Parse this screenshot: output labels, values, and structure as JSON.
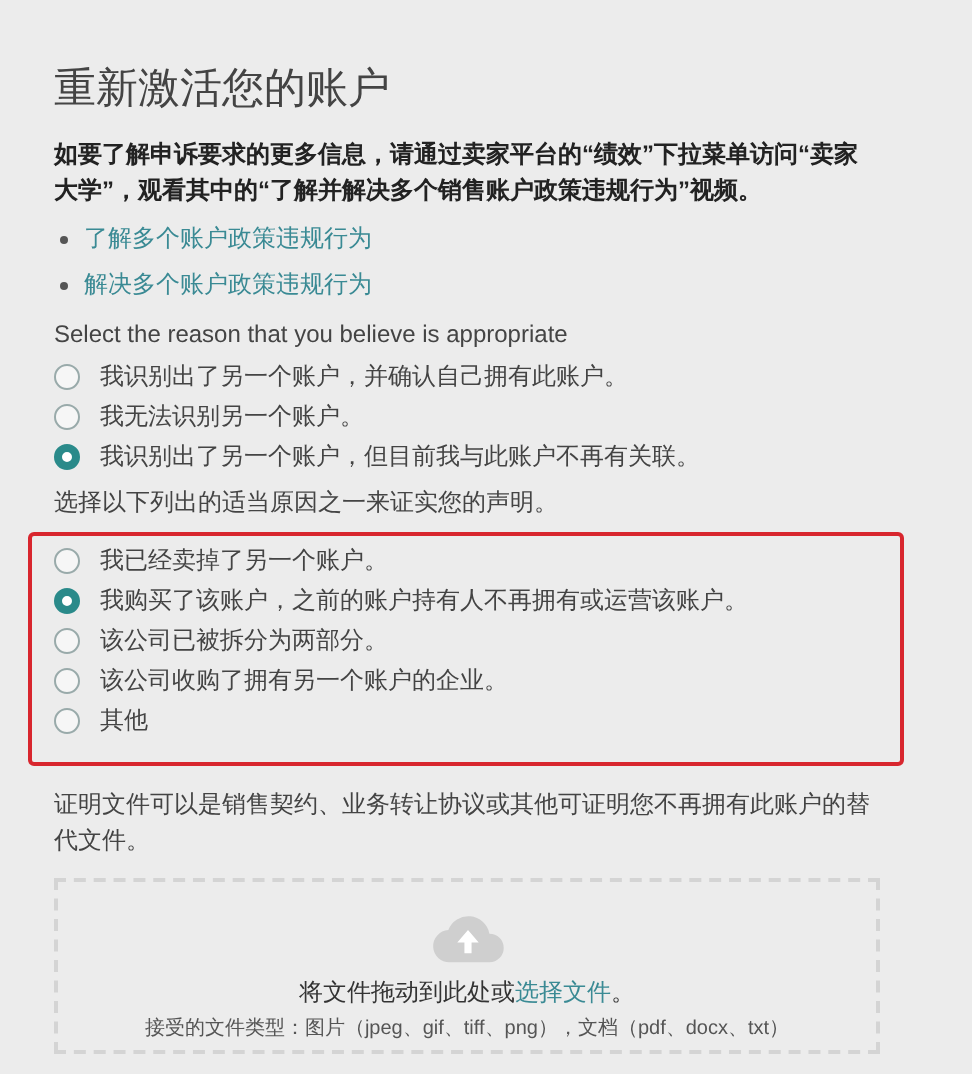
{
  "title": "重新激活您的账户",
  "intro": "如要了解申诉要求的更多信息，请通过卖家平台的“绩效”下拉菜单访问“卖家大学”，观看其中的“了解并解决多个销售账户政策违规行为”视频。",
  "links": [
    "了解多个账户政策违规行为",
    "解决多个账户政策违规行为"
  ],
  "reason_group": {
    "prompt": "Select the reason that you believe is appropriate",
    "highlighted": false,
    "options": [
      {
        "label": "我识别出了另一个账户，并确认自己拥有此账户。",
        "selected": false
      },
      {
        "label": "我无法识别另一个账户。",
        "selected": false
      },
      {
        "label": "我识别出了另一个账户，但目前我与此账户不再有关联。",
        "selected": true
      }
    ]
  },
  "statement_group": {
    "prompt": "选择以下列出的适当原因之一来证实您的声明。",
    "highlighted": true,
    "options": [
      {
        "label": "我已经卖掉了另一个账户。",
        "selected": false
      },
      {
        "label": "我购买了该账户，之前的账户持有人不再拥有或运营该账户。",
        "selected": true
      },
      {
        "label": "该公司已被拆分为两部分。",
        "selected": false
      },
      {
        "label": "该公司收购了拥有另一个账户的企业。",
        "selected": false
      },
      {
        "label": "其他",
        "selected": false
      }
    ]
  },
  "evidence_note": "证明文件可以是销售契约、业务转让协议或其他可证明您不再拥有此账户的替代文件。",
  "upload": {
    "text_before": "将文件拖动到此处或",
    "link": "选择文件",
    "text_after": "。",
    "accepted": "接受的文件类型：图片（jpeg、gif、tiff、png），文档（pdf、docx、txt）"
  }
}
